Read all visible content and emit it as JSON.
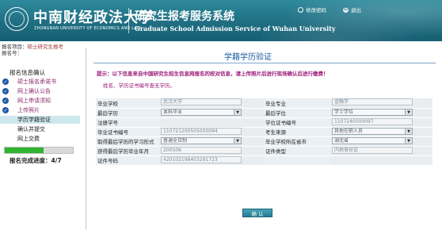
{
  "header": {
    "university_cn": "中南财经政法大学",
    "university_en": "ZHONGNAN UNIVERSITY OF ECONOMICS AND LAW",
    "system_cn": "研究生报考服务系统",
    "system_en": "Graduate School Admission Service of Wuhan University",
    "change_password": "修改密码",
    "logout": "退出"
  },
  "meta": {
    "project_label": "报名项目：",
    "project_value": "硕士研究生报考",
    "number_label": "报名号："
  },
  "sidebar": {
    "title": "报名信息确认",
    "items": [
      {
        "label": "硕士报名承诺书",
        "status": "done"
      },
      {
        "label": "网上确认公告",
        "status": "done"
      },
      {
        "label": "网上申请须知",
        "status": "done"
      },
      {
        "label": "上传照片",
        "status": "done"
      },
      {
        "label": "学历学籍验证",
        "status": "active"
      },
      {
        "label": "确认并提交",
        "status": "pending"
      },
      {
        "label": "网上交费",
        "status": "pending"
      }
    ],
    "progress_label": "报名完成进度：4/7",
    "progress_fraction": 0.57
  },
  "main": {
    "title": "学籍学历验证",
    "hint": "提示：以下信息来自中国研究生招生信息网报名的校对信息，请上传照片后进行现场确认后进行缴费！",
    "hint2": "姓名、学历证书编号查无学历。",
    "confirm_label": "确 认"
  },
  "form": {
    "rows": [
      {
        "l1": "毕业学校",
        "v1": "武汉大学",
        "t1": "text",
        "l2": "毕业专业",
        "v2": "金融学",
        "t2": "text"
      },
      {
        "l1": "最后学历",
        "v1": "本科毕业",
        "t1": "select",
        "l2": "最后学位",
        "v2": "学士学位",
        "t2": "select"
      },
      {
        "l1": "注册学号",
        "v1": "",
        "t1": "none",
        "l2": "学位证书编号",
        "v2": "1107240500097",
        "t2": "text"
      },
      {
        "l1": "毕业证书编号",
        "v1": "110721200505000094",
        "t1": "text",
        "l2": "考生来源",
        "v2": "其他在职人员",
        "t2": "select"
      },
      {
        "l1": "取得最后学历的学习形式",
        "v1": "普通全日制",
        "t1": "select",
        "l2": "毕业学校所在省市",
        "v2": "湖北省",
        "t2": "select"
      },
      {
        "l1": "获得最后学历毕业年月",
        "v1": "200506",
        "t1": "text",
        "l2": "证件类型",
        "v2": "内地身份证",
        "t2": "text"
      },
      {
        "l1": "证件号码",
        "v1": "420102198403291723",
        "t1": "text",
        "l2": "",
        "v2": "",
        "t2": "none"
      }
    ]
  }
}
